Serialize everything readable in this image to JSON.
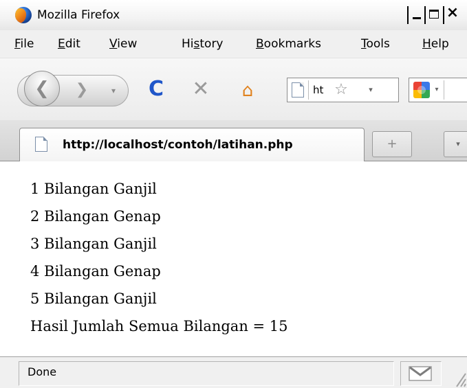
{
  "window": {
    "title": "Mozilla Firefox",
    "controls": {
      "minimize": "_",
      "maximize": "□",
      "close": "×"
    }
  },
  "menubar": {
    "items": [
      {
        "accel": "F",
        "rest": "ile"
      },
      {
        "accel": "E",
        "rest": "dit"
      },
      {
        "accel": "V",
        "rest": "iew"
      },
      {
        "before": "Hi",
        "accel": "s",
        "rest": "tory"
      },
      {
        "accel": "B",
        "rest": "ookmarks"
      },
      {
        "accel": "T",
        "rest": "ools"
      },
      {
        "accel": "H",
        "rest": "elp"
      }
    ]
  },
  "toolbar": {
    "back_glyph": "❮",
    "forward_glyph": "❯",
    "dropdown_glyph": "▾",
    "reload_glyph": "C",
    "stop_glyph": "✕",
    "home_glyph": "⌂",
    "url_visible": "ht",
    "star_glyph": "☆",
    "url_dropdown_glyph": "▾",
    "search_dropdown_glyph": "▾"
  },
  "tabs": {
    "active_title": "http://localhost/contoh/latihan.php",
    "new_tab_glyph": "+",
    "list_glyph": "▾"
  },
  "content": {
    "lines": [
      "1 Bilangan Ganjil",
      "2 Bilangan Genap",
      "3 Bilangan Ganjil",
      "4 Bilangan Genap",
      "5 Bilangan Ganjil",
      "Hasil Jumlah Semua Bilangan = 15"
    ]
  },
  "statusbar": {
    "text": "Done"
  },
  "colors": {
    "reload_blue": "#1f56c9",
    "home_orange": "#e0821e",
    "chrome_gray": "#f0f0f0"
  },
  "icons": {
    "app": "firefox-logo-icon",
    "site": "page-icon",
    "search_engine": "google-icon",
    "mail": "gmail-icon"
  }
}
